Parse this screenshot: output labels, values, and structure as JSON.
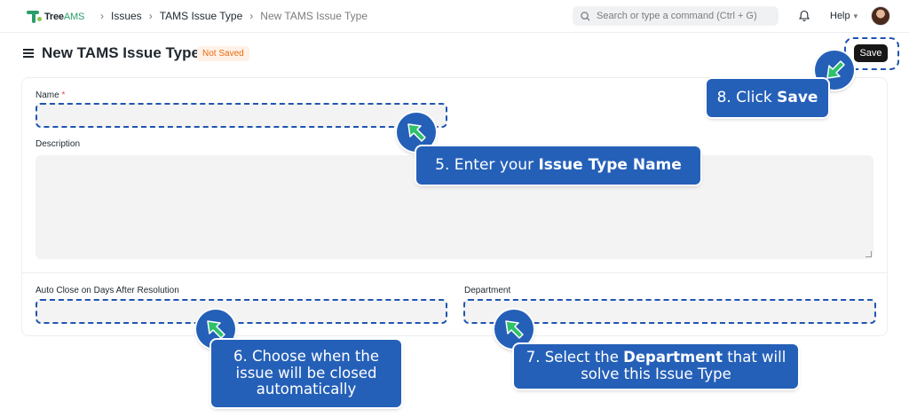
{
  "navbar": {
    "logo_text": "Tree",
    "logo_suffix": "AMS",
    "breadcrumbs": [
      "Issues",
      "TAMS Issue Type",
      "New TAMS Issue Type"
    ],
    "search_placeholder": "Search or type a command (Ctrl + G)",
    "help_label": "Help"
  },
  "page": {
    "title": "New TAMS Issue Type",
    "status_badge": "Not Saved",
    "save_label": "Save"
  },
  "form": {
    "name_label": "Name",
    "name_required_mark": "*",
    "description_label": "Description",
    "auto_close_label": "Auto Close on Days After Resolution",
    "department_label": "Department"
  },
  "callouts": {
    "step5": {
      "prefix": "5. Enter your ",
      "bold": "Issue Type Name",
      "suffix": ""
    },
    "step6": {
      "text": "6. Choose when the issue will be closed automatically"
    },
    "step7": {
      "prefix": "7. Select the ",
      "bold": "Department",
      "suffix": " that will solve this Issue Type"
    },
    "step8": {
      "prefix": "8. Click ",
      "bold": "Save",
      "suffix": ""
    }
  },
  "colors": {
    "callout_bg": "#2560b8",
    "arrow_green": "#2ec26a",
    "dashed_highlight": "#1f55b0",
    "not_saved_text": "#e86c13"
  }
}
